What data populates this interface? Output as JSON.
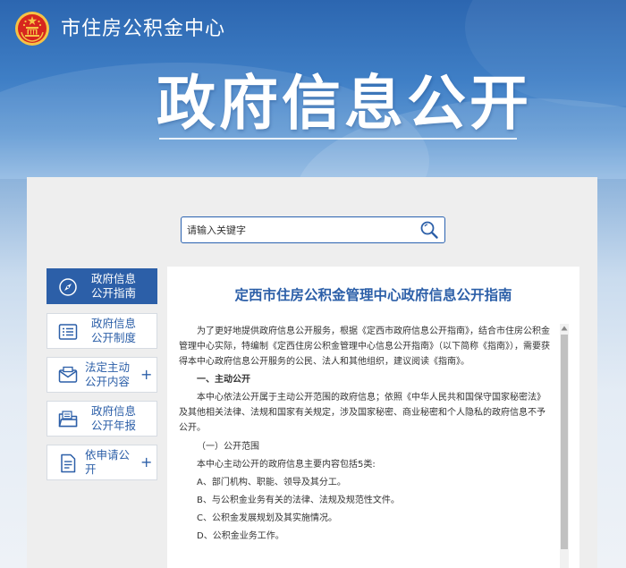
{
  "header": {
    "site_name": "市住房公积金中心",
    "banner_title": "政府信息公开"
  },
  "search": {
    "placeholder": "请输入关键字"
  },
  "sidebar": {
    "items": [
      {
        "line1": "政府信息",
        "line2": "公开指南",
        "icon": "compass-icon",
        "active": true,
        "expandable": false
      },
      {
        "line1": "政府信息",
        "line2": "公开制度",
        "icon": "list-icon",
        "active": false,
        "expandable": false
      },
      {
        "line1": "法定主动",
        "line2": "公开内容",
        "icon": "envelope-icon",
        "active": false,
        "expandable": true,
        "expand_label": "+"
      },
      {
        "line1": "政府信息",
        "line2": "公开年报",
        "icon": "folder-icon",
        "active": false,
        "expandable": false
      },
      {
        "line1": "依申请公",
        "line2": "开",
        "icon": "document-icon",
        "active": false,
        "expandable": true,
        "expand_label": "+"
      }
    ]
  },
  "document": {
    "title": "定西市住房公积金管理中心政府信息公开指南",
    "intro": "为了更好地提供政府信息公开服务，根据《定西市政府信息公开指南》，结合市住房公积金管理中心实际，特编制《定西住房公积金管理中心信息公开指南》（以下简称《指南》），需要获得本中心政府信息公开服务的公民、法人和其他组织，建议阅读《指南》。",
    "section1_heading": "一、主动公开",
    "section1_text": "本中心依法公开属于主动公开范围的政府信息；依照《中华人民共和国保守国家秘密法》及其他相关法律、法规和国家有关规定，涉及国家秘密、商业秘密和个人隐私的政府信息不予公开。",
    "sub1_heading": "（一）公开范围",
    "sub1_text": "本中心主动公开的政府信息主要内容包括5类:",
    "list": [
      "A、部门机构、职能、领导及其分工。",
      "B、与公积金业务有关的法律、法规及规范性文件。",
      "C、公积金发展规划及其实施情况。",
      "D、公积金业务工作。"
    ]
  },
  "colors": {
    "brand_blue": "#2c5fa8",
    "header_blue": "#2c66b0",
    "emblem_red": "#d7261e",
    "emblem_gold": "#f6c344"
  }
}
